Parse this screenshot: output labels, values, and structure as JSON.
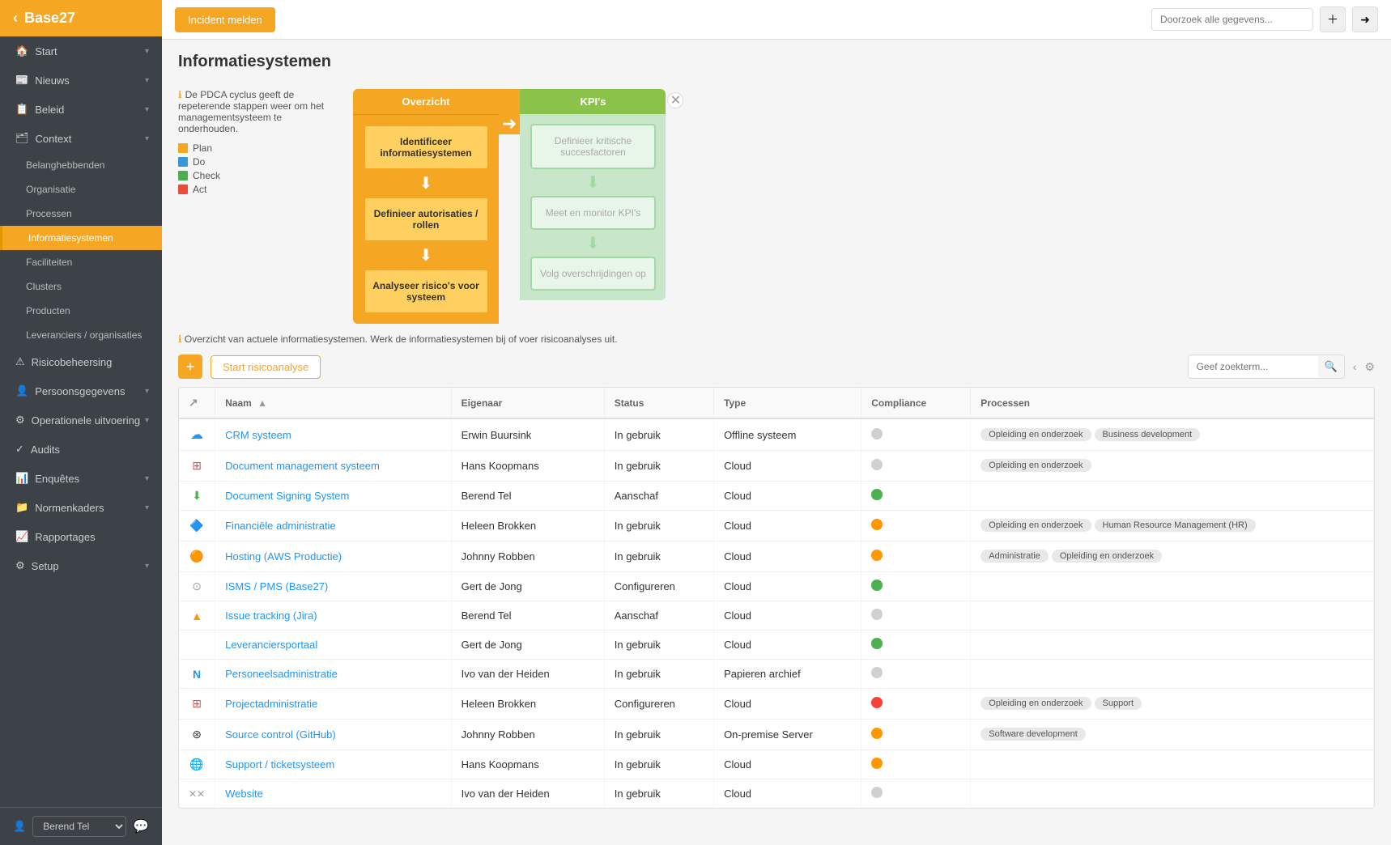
{
  "app": {
    "title": "Base27",
    "incident_btn": "Incident melden",
    "search_placeholder": "Doorzoek alle gegevens...",
    "user_name": "Berend Tel"
  },
  "sidebar": {
    "items": [
      {
        "id": "start",
        "label": "Start",
        "icon": "🏠",
        "has_chevron": true
      },
      {
        "id": "nieuws",
        "label": "Nieuws",
        "icon": "📰",
        "has_chevron": true
      },
      {
        "id": "beleid",
        "label": "Beleid",
        "icon": "📋",
        "has_chevron": true
      },
      {
        "id": "context",
        "label": "Context",
        "icon": "🗂",
        "has_chevron": true
      },
      {
        "id": "belanghebbenden",
        "label": "Belanghebbenden",
        "sub": true
      },
      {
        "id": "organisatie",
        "label": "Organisatie",
        "sub": true
      },
      {
        "id": "processen",
        "label": "Processen",
        "sub": true
      },
      {
        "id": "informatiesystemen",
        "label": "Informatiesystemen",
        "sub": true,
        "active": true
      },
      {
        "id": "faciliteiten",
        "label": "Faciliteiten",
        "sub": true
      },
      {
        "id": "clusters",
        "label": "Clusters",
        "sub": true
      },
      {
        "id": "producten",
        "label": "Producten",
        "sub": true
      },
      {
        "id": "leveranciers",
        "label": "Leveranciers / organisaties",
        "sub": true
      },
      {
        "id": "risicobeheersing",
        "label": "Risicobeheersing",
        "icon": "⚠",
        "has_chevron": false
      },
      {
        "id": "persoonsgegevens",
        "label": "Persoonsgegevens",
        "icon": "👤",
        "has_chevron": true
      },
      {
        "id": "operationele",
        "label": "Operationele uitvoering",
        "icon": "⚙",
        "has_chevron": true
      },
      {
        "id": "audits",
        "label": "Audits",
        "icon": "✓",
        "has_chevron": false
      },
      {
        "id": "enquetes",
        "label": "Enquêtes",
        "icon": "📊",
        "has_chevron": true
      },
      {
        "id": "normenkaders",
        "label": "Normenkaders",
        "icon": "📁",
        "has_chevron": true
      },
      {
        "id": "rapportages",
        "label": "Rapportages",
        "icon": "📈",
        "has_chevron": false
      },
      {
        "id": "setup",
        "label": "Setup",
        "icon": "⚙",
        "has_chevron": true
      }
    ]
  },
  "page": {
    "title": "Informatiesystemen",
    "pdca_info": "De PDCA cyclus geeft de repeterende stappen weer om het managementsysteem te onderhouden.",
    "overzicht_label": "Overzicht",
    "kpis_label": "KPI's",
    "legend": [
      {
        "label": "Plan",
        "color": "#f5a623"
      },
      {
        "label": "Do",
        "color": "#3498db"
      },
      {
        "label": "Check",
        "color": "#4caf50"
      },
      {
        "label": "Act",
        "color": "#e74c3c"
      }
    ],
    "pdca_boxes_orange": [
      "Identificeer informatiesystemen",
      "Definieer autorisaties / rollen",
      "Analyseer risico's voor systeem"
    ],
    "pdca_boxes_green": [
      "Definieer kritische succesfactoren",
      "Meet en monitor KPI's",
      "Volg overschrijdingen op"
    ],
    "info_text": "Overzicht van actuele informatiesystemen. Werk de informatiesystemen bij of voer risicoanalyses uit.",
    "add_btn_label": "+",
    "start_analysis_btn": "Start risicoanalyse",
    "search_placeholder": "Geef zoekterm...",
    "table": {
      "columns": [
        {
          "id": "icon",
          "label": ""
        },
        {
          "id": "naam",
          "label": "Naam",
          "sortable": true
        },
        {
          "id": "eigenaar",
          "label": "Eigenaar"
        },
        {
          "id": "status",
          "label": "Status"
        },
        {
          "id": "type",
          "label": "Type"
        },
        {
          "id": "compliance",
          "label": "Compliance"
        },
        {
          "id": "processen",
          "label": "Processen"
        }
      ],
      "rows": [
        {
          "icon": "☁",
          "icon_color": "#2196f3",
          "naam": "CRM systeem",
          "eigenaar": "Erwin Buursink",
          "status": "In gebruik",
          "type": "Offline systeem",
          "compliance": "grey",
          "processes": [
            "Opleiding en onderzoek",
            "Business development"
          ]
        },
        {
          "icon": "⊞",
          "icon_color": "#f44336",
          "naam": "Document management systeem",
          "eigenaar": "Hans Koopmans",
          "status": "In gebruik",
          "type": "Cloud",
          "compliance": "grey",
          "processes": [
            "Opleiding en onderzoek"
          ]
        },
        {
          "icon": "⬇",
          "icon_color": "#4caf50",
          "naam": "Document Signing System",
          "eigenaar": "Berend Tel",
          "status": "Aanschaf",
          "type": "Cloud",
          "compliance": "green",
          "processes": []
        },
        {
          "icon": "🔷",
          "icon_color": "#607d8b",
          "naam": "Financiële administratie",
          "eigenaar": "Heleen Brokken",
          "status": "In gebruik",
          "type": "Cloud",
          "compliance": "orange",
          "processes": [
            "Opleiding en onderzoek",
            "Human Resource Management (HR)"
          ]
        },
        {
          "icon": "🟠",
          "icon_color": "#ff9800",
          "naam": "Hosting (AWS Productie)",
          "eigenaar": "Johnny Robben",
          "status": "In gebruik",
          "type": "Cloud",
          "compliance": "orange",
          "processes": [
            "Administratie",
            "Opleiding en onderzoek"
          ]
        },
        {
          "icon": "⊙",
          "icon_color": "#9e9e9e",
          "naam": "ISMS / PMS (Base27)",
          "eigenaar": "Gert de Jong",
          "status": "Configureren",
          "type": "Cloud",
          "compliance": "green",
          "processes": []
        },
        {
          "icon": "▲",
          "icon_color": "#ff9800",
          "naam": "Issue tracking (Jira)",
          "eigenaar": "Berend Tel",
          "status": "Aanschaf",
          "type": "Cloud",
          "compliance": "grey",
          "processes": []
        },
        {
          "icon": "",
          "icon_color": "",
          "naam": "Leveranciersportaal",
          "eigenaar": "Gert de Jong",
          "status": "In gebruik",
          "type": "Cloud",
          "compliance": "green",
          "processes": []
        },
        {
          "icon": "N",
          "icon_color": "#2196f3",
          "naam": "Personeelsadministratie",
          "eigenaar": "Ivo van der Heiden",
          "status": "In gebruik",
          "type": "Papieren archief",
          "compliance": "grey",
          "processes": []
        },
        {
          "icon": "⊞",
          "icon_color": "#f44336",
          "naam": "Projectadministratie",
          "eigenaar": "Heleen Brokken",
          "status": "Configureren",
          "type": "Cloud",
          "compliance": "red",
          "processes": [
            "Opleiding en onderzoek",
            "Support"
          ]
        },
        {
          "icon": "⊛",
          "icon_color": "#333",
          "naam": "Source control (GitHub)",
          "eigenaar": "Johnny Robben",
          "status": "In gebruik",
          "type": "On-premise Server",
          "compliance": "orange",
          "processes": [
            "Software development"
          ]
        },
        {
          "icon": "🌐",
          "icon_color": "#4caf50",
          "naam": "Support / ticketsysteem",
          "eigenaar": "Hans Koopmans",
          "status": "In gebruik",
          "type": "Cloud",
          "compliance": "orange",
          "processes": []
        },
        {
          "icon": "✕✕",
          "icon_color": "#9e9e9e",
          "naam": "Website",
          "eigenaar": "Ivo van der Heiden",
          "status": "In gebruik",
          "type": "Cloud",
          "compliance": "grey",
          "processes": []
        }
      ]
    }
  }
}
